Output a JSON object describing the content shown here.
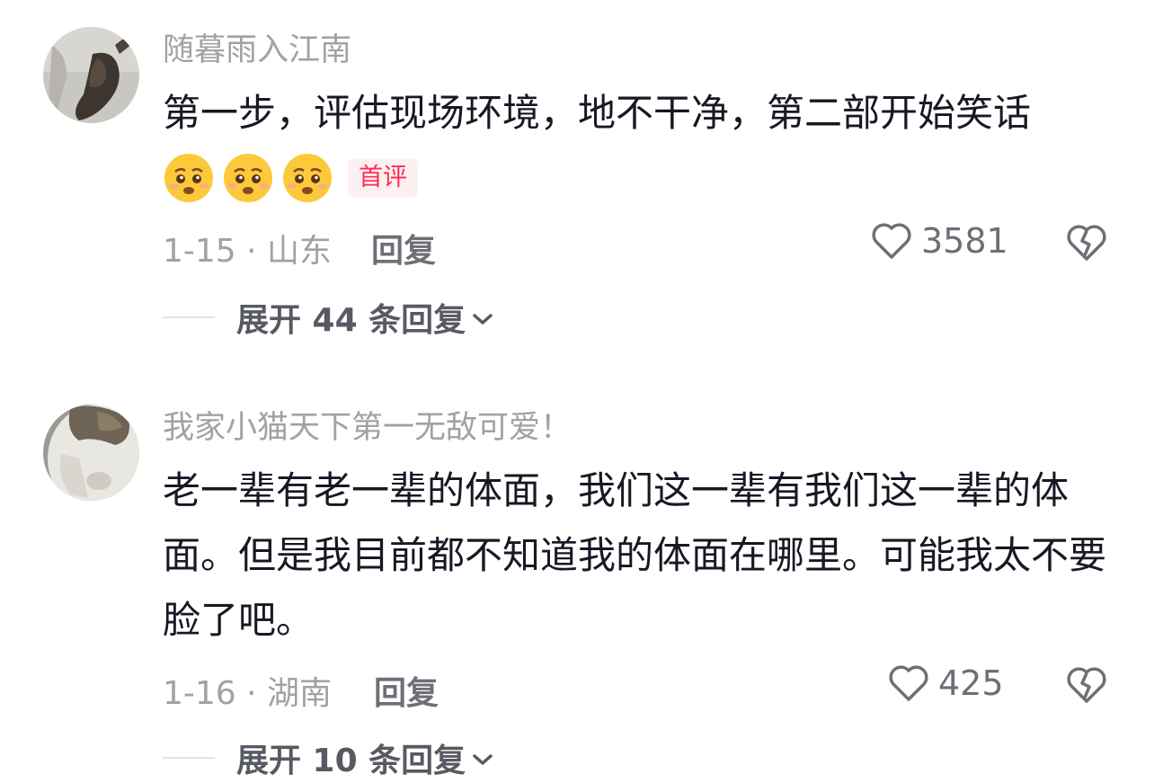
{
  "comments": [
    {
      "username": "随暮雨入江南",
      "text": "第一步，评估现场环境，地不干净，第二部开始笑话",
      "emojis": [
        "pleading-face-emoji",
        "pleading-face-emoji",
        "pleading-face-emoji"
      ],
      "badge": "首评",
      "date_location": "1-15 · 山东",
      "reply_label": "回复",
      "likes": "3581",
      "expand_label": "展开 44 条回复"
    },
    {
      "username": "我家小猫天下第一无敌可爱！",
      "text": "老一辈有老一辈的体面，我们这一辈有我们这一辈的体面。但是我目前都不知道我的体面在哪里。可能我太不要脸了吧。",
      "date_location": "1-16 · 湖南",
      "reply_label": "回复",
      "likes": "425",
      "expand_label": "展开 10 条回复"
    }
  ],
  "icons": {
    "like": "heart-outline-icon",
    "dislike": "broken-heart-icon",
    "expand": "chevron-down-icon"
  },
  "colors": {
    "username": "#a1a1a6",
    "body": "#161823",
    "badge_text": "#fe2c55",
    "badge_bg": "#fdf0f2",
    "meta": "#a1a1a6",
    "expand_text": "#575a63"
  }
}
